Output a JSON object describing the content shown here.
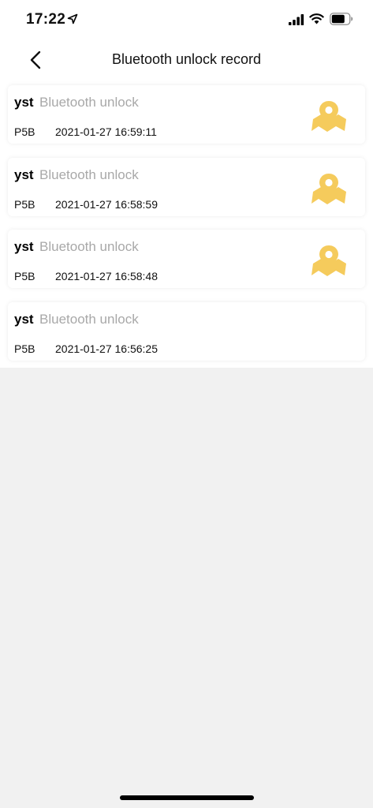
{
  "status_bar": {
    "time": "17:22",
    "icons": [
      "location-arrow-icon",
      "cellular-signal-icon",
      "wifi-icon",
      "battery-icon"
    ]
  },
  "nav": {
    "title": "Bluetooth unlock record",
    "back_icon": "chevron-left-icon"
  },
  "colors": {
    "accent_icon": "#f5cb5c",
    "muted_text": "#a8a8a8",
    "page_background": "#f1f1f1"
  },
  "records": [
    {
      "name": "yst",
      "action": "Bluetooth unlock",
      "device": "P5B",
      "time": "2021-01-27 16:59:11",
      "has_location": true
    },
    {
      "name": "yst",
      "action": "Bluetooth unlock",
      "device": "P5B",
      "time": "2021-01-27 16:58:59",
      "has_location": true
    },
    {
      "name": "yst",
      "action": "Bluetooth unlock",
      "device": "P5B",
      "time": "2021-01-27 16:58:48",
      "has_location": true
    },
    {
      "name": "yst",
      "action": "Bluetooth unlock",
      "device": "P5B",
      "time": "2021-01-27 16:56:25",
      "has_location": false
    }
  ]
}
